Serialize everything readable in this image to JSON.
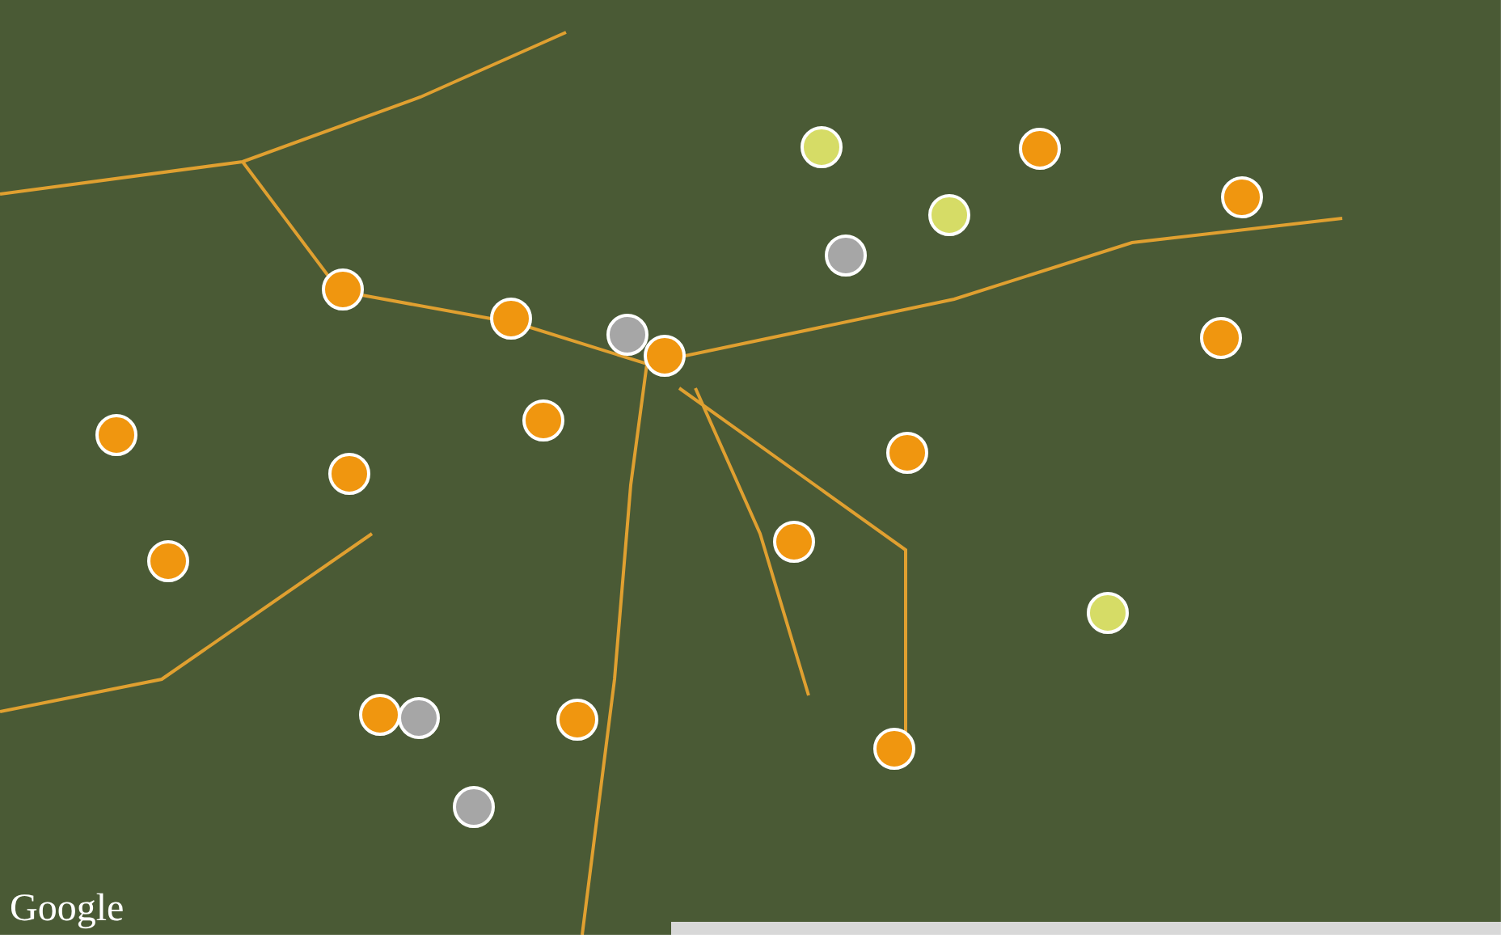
{
  "map": {
    "logo": "Google",
    "markers": [
      {
        "color": "#f0960f"
      },
      {
        "color": "#d6dc66"
      },
      {
        "color": "#f0960f"
      },
      {
        "color": "#f0960f"
      },
      {
        "color": "#d6dc66"
      },
      {
        "color": "#a6a6a6"
      },
      {
        "color": "#f0960f"
      },
      {
        "color": "#f0960f"
      },
      {
        "color": "#a6a6a6"
      },
      {
        "color": "#f0960f"
      },
      {
        "color": "#f0960f"
      },
      {
        "color": "#f0960f"
      },
      {
        "color": "#f0960f"
      },
      {
        "color": "#f0960f"
      },
      {
        "color": "#f0960f"
      },
      {
        "color": "#f0960f"
      },
      {
        "color": "#f0960f"
      },
      {
        "color": "#d6dc66"
      },
      {
        "color": "#f0960f"
      },
      {
        "color": "#a6a6a6"
      },
      {
        "color": "#f0960f"
      },
      {
        "color": "#a6a6a6"
      }
    ]
  }
}
